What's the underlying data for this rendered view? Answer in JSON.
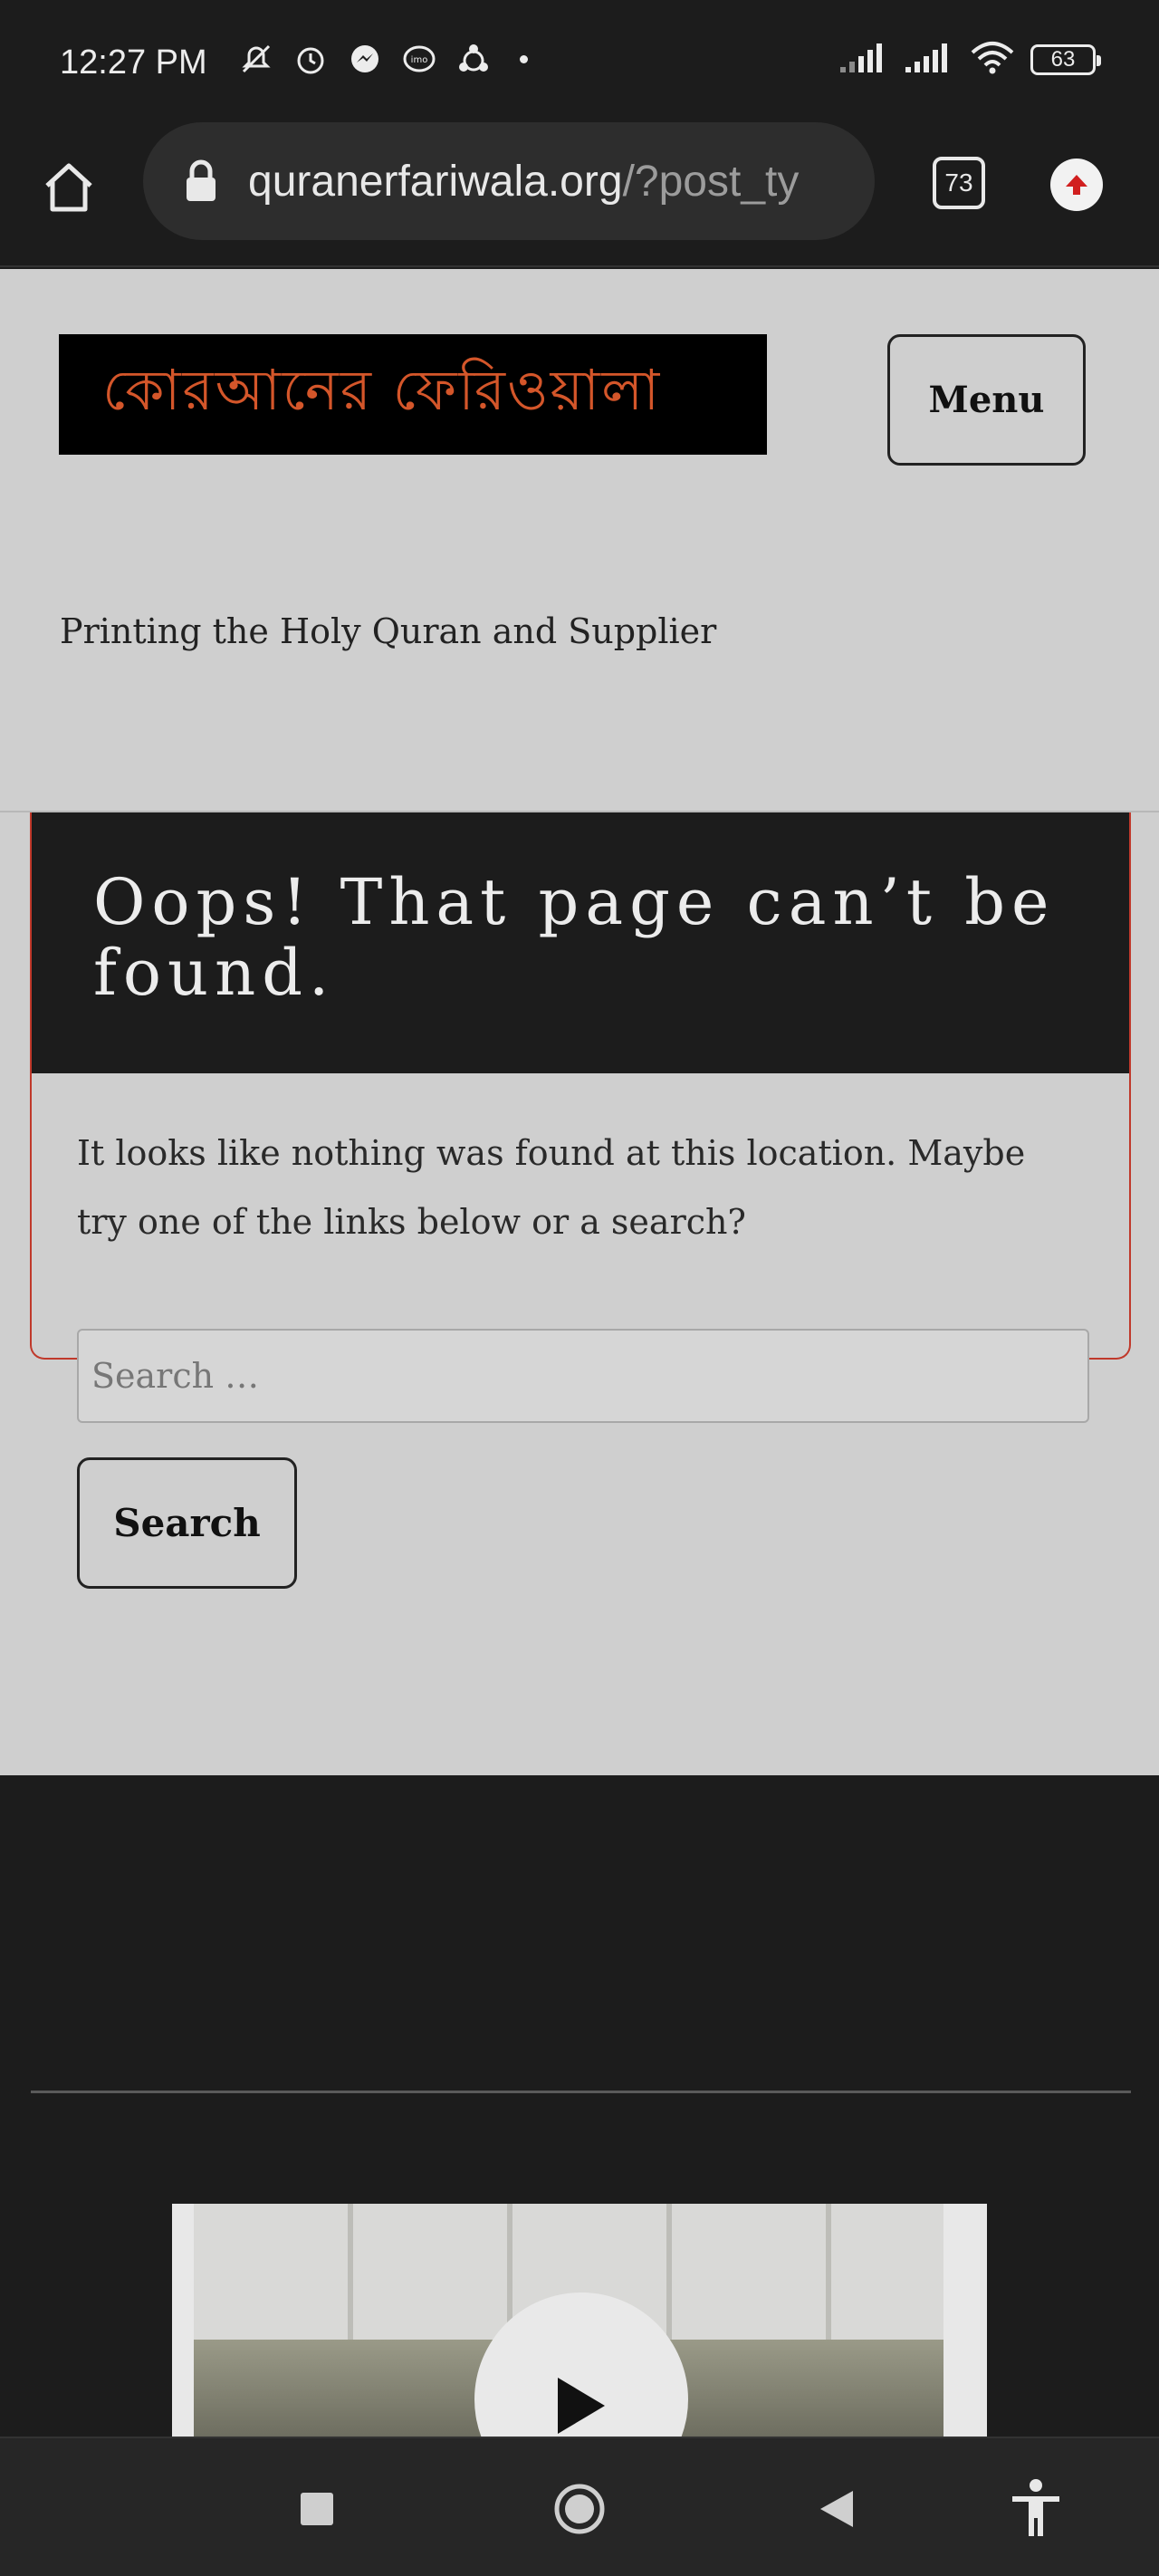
{
  "status_bar": {
    "time": "12:27 PM",
    "battery": "63",
    "icons": [
      "mute-icon",
      "alarm-icon",
      "messenger-icon",
      "imo-icon",
      "sync-icon",
      "signal-icon",
      "signal-icon",
      "wifi-icon",
      "battery-icon"
    ]
  },
  "browser": {
    "url_main": "quranerfariwala.org",
    "url_rest": "/?post_ty",
    "tab_count": "73"
  },
  "site": {
    "logo_text": "কোরআনের ফেরিওয়ালা",
    "menu_label": "Menu",
    "tagline": "Printing the Holy Quran and Supplier"
  },
  "error": {
    "title": "Oops! That page can’t be found.",
    "message": "It looks like nothing was found at this location. Maybe try one of the links below or a search?",
    "search_placeholder": "Search …",
    "search_button": "Search"
  },
  "colors": {
    "page_bg": "#cfcfcf",
    "dark_bg": "#1c1c1c",
    "logo_text": "#d4562a",
    "card_border": "#c0392b"
  }
}
